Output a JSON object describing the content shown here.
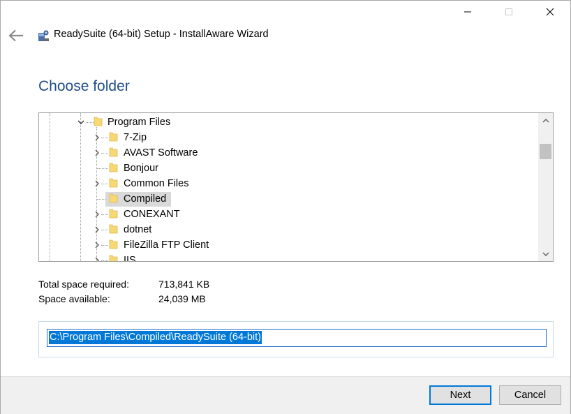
{
  "window": {
    "title": "ReadySuite (64-bit) Setup - InstallAware Wizard"
  },
  "page": {
    "heading": "Choose folder"
  },
  "tree": {
    "parent": {
      "label": "Program Files",
      "expanded": true
    },
    "items": [
      {
        "label": "7-Zip",
        "has_children": true,
        "selected": false
      },
      {
        "label": "AVAST Software",
        "has_children": true,
        "selected": false
      },
      {
        "label": "Bonjour",
        "has_children": false,
        "selected": false
      },
      {
        "label": "Common Files",
        "has_children": true,
        "selected": false
      },
      {
        "label": "Compiled",
        "has_children": false,
        "selected": true
      },
      {
        "label": "CONEXANT",
        "has_children": true,
        "selected": false
      },
      {
        "label": "dotnet",
        "has_children": true,
        "selected": false
      },
      {
        "label": "FileZilla FTP Client",
        "has_children": true,
        "selected": false
      },
      {
        "label": "IIS",
        "has_children": true,
        "selected": false
      }
    ]
  },
  "space": {
    "required_label": "Total space required:",
    "required_value": "713,841 KB",
    "available_label": "Space available:",
    "available_value": "24,039 MB"
  },
  "path": {
    "value": "C:\\Program Files\\Compiled\\ReadySuite (64-bit)"
  },
  "buttons": {
    "next": "Next",
    "cancel": "Cancel"
  },
  "colors": {
    "heading": "#1f4e8c",
    "accent": "#0078d7",
    "folder": "#f8d775"
  },
  "icons": {
    "back": "back-arrow-icon",
    "app": "installer-app-icon",
    "folder": "folder-icon",
    "expand": "chevron-right-icon",
    "collapse": "chevron-down-icon"
  }
}
